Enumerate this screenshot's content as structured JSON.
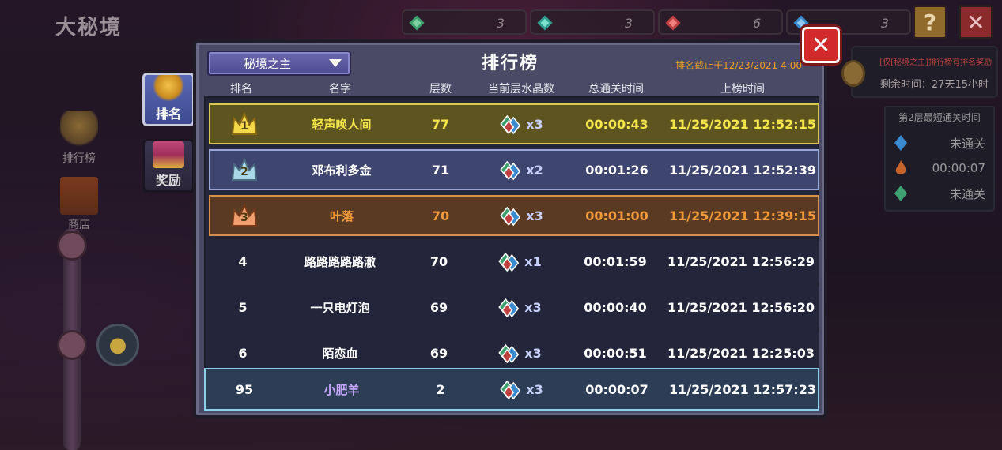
{
  "game_title": "大秘境",
  "resources": [
    {
      "icon": "green-gem-icon",
      "count": "3",
      "color": "#3fa070"
    },
    {
      "icon": "teal-gem-icon",
      "count": "3",
      "color": "#2fa090"
    },
    {
      "icon": "red-gem-icon",
      "count": "6",
      "color": "#c04040"
    },
    {
      "icon": "blue-gem-icon",
      "count": "3",
      "color": "#3a8ad0"
    }
  ],
  "top_buttons": {
    "help": "?",
    "close": "✕"
  },
  "side_nav": [
    {
      "icon": "trophy-icon",
      "label": "排行榜"
    },
    {
      "icon": "shop-icon",
      "label": "商店"
    }
  ],
  "tabs": [
    {
      "icon": "trophy-icon",
      "label": "排名",
      "active": true
    },
    {
      "icon": "treasure-chest-icon",
      "label": "奖励",
      "active": false
    }
  ],
  "panel": {
    "dropdown_value": "秘境之主",
    "title": "排行榜",
    "deadline": "排名截止于12/23/2021 4:00",
    "close": "✕"
  },
  "headers": [
    "排名",
    "名字",
    "层数",
    "当前层水晶数",
    "总通关时间",
    "上榜时间"
  ],
  "rows": [
    {
      "rank": "1",
      "name": "轻声唤人间",
      "floors": "77",
      "crystals": "x3",
      "total_time": "00:00:43",
      "time": "11/25/2021 12:52:15"
    },
    {
      "rank": "2",
      "name": "邓布利多金",
      "floors": "71",
      "crystals": "x2",
      "total_time": "00:01:26",
      "time": "11/25/2021 12:52:39"
    },
    {
      "rank": "3",
      "name": "叶落",
      "floors": "70",
      "crystals": "x3",
      "total_time": "00:01:00",
      "time": "11/25/2021 12:39:15"
    },
    {
      "rank": "4",
      "name": "路路路路路澈",
      "floors": "70",
      "crystals": "x1",
      "total_time": "00:01:59",
      "time": "11/25/2021 12:56:29"
    },
    {
      "rank": "5",
      "name": "一只电灯泡",
      "floors": "69",
      "crystals": "x3",
      "total_time": "00:00:40",
      "time": "11/25/2021 12:56:20"
    },
    {
      "rank": "6",
      "name": "陌恋血",
      "floors": "69",
      "crystals": "x3",
      "total_time": "00:00:51",
      "time": "11/25/2021 12:25:03"
    }
  ],
  "my_row": {
    "rank": "95",
    "name": "小肥羊",
    "floors": "2",
    "crystals": "x3",
    "total_time": "00:00:07",
    "time": "11/25/2021 12:57:23"
  },
  "right_info": {
    "head": "[仅[秘境之主]排行榜有排名奖励",
    "remain": "剩余时间：27天15小时"
  },
  "clear_box": {
    "head": "第2层最短通关时间",
    "rows": [
      {
        "icon": "blue-gem-icon",
        "value": "未通关"
      },
      {
        "icon": "fire-icon",
        "value": "00:00:07"
      },
      {
        "icon": "green-gem-icon",
        "value": "未通关"
      }
    ]
  },
  "colors": {
    "gold": "#f5e64a",
    "silver": "#9aa8d8",
    "bronze": "#f39a3a",
    "deadline": "#f0a020",
    "close": "#d22a2a"
  }
}
